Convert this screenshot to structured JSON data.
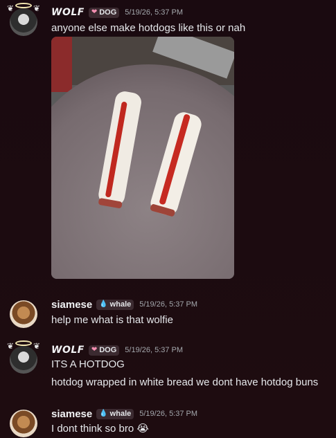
{
  "messages": [
    {
      "author": "WOLF",
      "tag": "DOG",
      "time": "5/19/26, 5:37 PM",
      "lines": [
        "anyone else make hotdogs like this or nah"
      ],
      "has_image": true
    },
    {
      "author": "siamese",
      "tag": "whale",
      "time": "5/19/26, 5:37 PM",
      "lines": [
        "help me what is that wolfie"
      ]
    },
    {
      "author": "WOLF",
      "tag": "DOG",
      "time": "5/19/26, 5:37 PM",
      "lines": [
        "ITS A HOTDOG",
        "hotdog wrapped in white bread we dont have hotdog buns"
      ]
    },
    {
      "author": "siamese",
      "tag": "whale",
      "time": "5/19/26, 5:37 PM",
      "lines": [
        "I dont think so bro"
      ],
      "emoji": "😭"
    }
  ],
  "colors": {
    "background": "#1c0b10",
    "tag_bg": "#3b2a30",
    "heart": "#f48fb1",
    "drop": "#5fd3f3"
  }
}
